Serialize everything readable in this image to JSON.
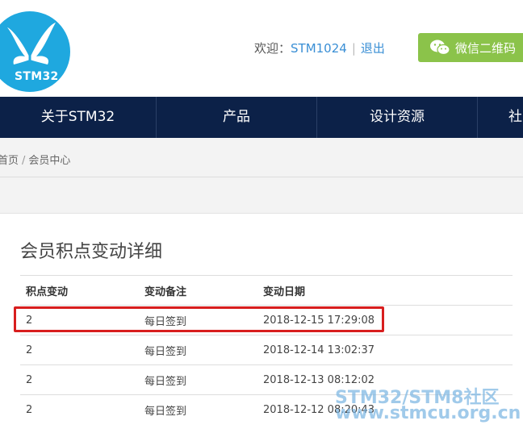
{
  "header": {
    "logo_text": "STM32",
    "welcome_label": "欢迎：",
    "username": "STM1024",
    "separator": "|",
    "logout": "退出",
    "wechat_button": "微信二维码"
  },
  "nav": {
    "items": [
      "关于STM32",
      "产品",
      "设计资源",
      "社"
    ]
  },
  "breadcrumb": {
    "home": "首页",
    "separator": "/",
    "current": "会员中心"
  },
  "main": {
    "title": "会员积点变动详细",
    "columns": [
      "积点变动",
      "变动备注",
      "变动日期"
    ],
    "rows": [
      {
        "points": "2",
        "note": "每日签到",
        "date": "2018-12-15 17:29:08"
      },
      {
        "points": "2",
        "note": "每日签到",
        "date": "2018-12-14 13:02:37"
      },
      {
        "points": "2",
        "note": "每日签到",
        "date": "2018-12-13 08:12:02"
      },
      {
        "points": "2",
        "note": "每日签到",
        "date": "2018-12-12 08:20:43"
      }
    ]
  },
  "watermark": {
    "line1": "STM32/STM8社区",
    "line2": "www.stmcu.org.cn"
  },
  "colors": {
    "nav_bg": "#0c2148",
    "logo_bg": "#1fa8df",
    "wechat_bg": "#8bc34a",
    "link": "#3a8fd5",
    "highlight": "#d81e1e"
  }
}
